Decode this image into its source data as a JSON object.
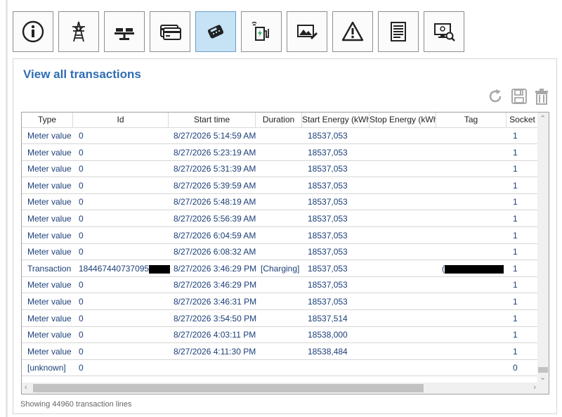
{
  "toolbar": {
    "buttons": [
      {
        "icon": "info-icon",
        "active": false
      },
      {
        "icon": "power-tower-icon",
        "active": false
      },
      {
        "icon": "balance-scale-icon",
        "active": false
      },
      {
        "icon": "credit-card-icon",
        "active": false
      },
      {
        "icon": "payment-terminal-icon",
        "active": true
      },
      {
        "icon": "charging-station-icon",
        "active": false
      },
      {
        "icon": "image-edit-icon",
        "active": false
      },
      {
        "icon": "warning-icon",
        "active": false
      },
      {
        "icon": "document-icon",
        "active": false
      },
      {
        "icon": "monitor-search-icon",
        "active": false
      }
    ]
  },
  "panel": {
    "title": "View all transactions",
    "actions": [
      "refresh-icon",
      "save-icon",
      "delete-icon"
    ],
    "status": "Showing 44960 transaction lines"
  },
  "grid": {
    "columns": [
      "Type",
      "Id",
      "Start time",
      "Duration",
      "Start Energy (kWh)",
      "Stop Energy (kWh)",
      "Tag",
      "Socket"
    ],
    "rows": [
      {
        "type": "Meter value",
        "id": "0",
        "start": "8/27/2026 5:14:59 AM",
        "duration": "",
        "start_energy": "18537,053",
        "stop_energy": "",
        "tag": "",
        "socket": "1"
      },
      {
        "type": "Meter value",
        "id": "0",
        "start": "8/27/2026 5:23:19 AM",
        "duration": "",
        "start_energy": "18537,053",
        "stop_energy": "",
        "tag": "",
        "socket": "1"
      },
      {
        "type": "Meter value",
        "id": "0",
        "start": "8/27/2026 5:31:39 AM",
        "duration": "",
        "start_energy": "18537,053",
        "stop_energy": "",
        "tag": "",
        "socket": "1"
      },
      {
        "type": "Meter value",
        "id": "0",
        "start": "8/27/2026 5:39:59 AM",
        "duration": "",
        "start_energy": "18537,053",
        "stop_energy": "",
        "tag": "",
        "socket": "1"
      },
      {
        "type": "Meter value",
        "id": "0",
        "start": "8/27/2026 5:48:19 AM",
        "duration": "",
        "start_energy": "18537,053",
        "stop_energy": "",
        "tag": "",
        "socket": "1"
      },
      {
        "type": "Meter value",
        "id": "0",
        "start": "8/27/2026 5:56:39 AM",
        "duration": "",
        "start_energy": "18537,053",
        "stop_energy": "",
        "tag": "",
        "socket": "1"
      },
      {
        "type": "Meter value",
        "id": "0",
        "start": "8/27/2026 6:04:59 AM",
        "duration": "",
        "start_energy": "18537,053",
        "stop_energy": "",
        "tag": "",
        "socket": "1"
      },
      {
        "type": "Meter value",
        "id": "0",
        "start": "8/27/2026 6:08:32 AM",
        "duration": "",
        "start_energy": "18537,053",
        "stop_energy": "",
        "tag": "",
        "socket": "1"
      },
      {
        "type": "Transaction",
        "id": "184467440737095",
        "start": "8/27/2026 3:46:29 PM",
        "duration": "[Charging]",
        "start_energy": "18537,053",
        "stop_energy": "",
        "tag": "(",
        "socket": "1",
        "redacted": true
      },
      {
        "type": "Meter value",
        "id": "0",
        "start": "8/27/2026 3:46:29 PM",
        "duration": "",
        "start_energy": "18537,053",
        "stop_energy": "",
        "tag": "",
        "socket": "1"
      },
      {
        "type": "Meter value",
        "id": "0",
        "start": "8/27/2026 3:46:31 PM",
        "duration": "",
        "start_energy": "18537,053",
        "stop_energy": "",
        "tag": "",
        "socket": "1"
      },
      {
        "type": "Meter value",
        "id": "0",
        "start": "8/27/2026 3:54:50 PM",
        "duration": "",
        "start_energy": "18537,514",
        "stop_energy": "",
        "tag": "",
        "socket": "1"
      },
      {
        "type": "Meter value",
        "id": "0",
        "start": "8/27/2026 4:03:11 PM",
        "duration": "",
        "start_energy": "18538,000",
        "stop_energy": "",
        "tag": "",
        "socket": "1"
      },
      {
        "type": "Meter value",
        "id": "0",
        "start": "8/27/2026 4:11:30 PM",
        "duration": "",
        "start_energy": "18538,484",
        "stop_energy": "",
        "tag": "",
        "socket": "1"
      },
      {
        "type": "[unknown]",
        "id": "0",
        "start": "",
        "duration": "",
        "start_energy": "",
        "stop_energy": "",
        "tag": "",
        "socket": "0"
      }
    ]
  },
  "colors": {
    "accent": "#2f6db3",
    "cell_text": "#1c3f78",
    "active_button": "#c6e2f5"
  }
}
